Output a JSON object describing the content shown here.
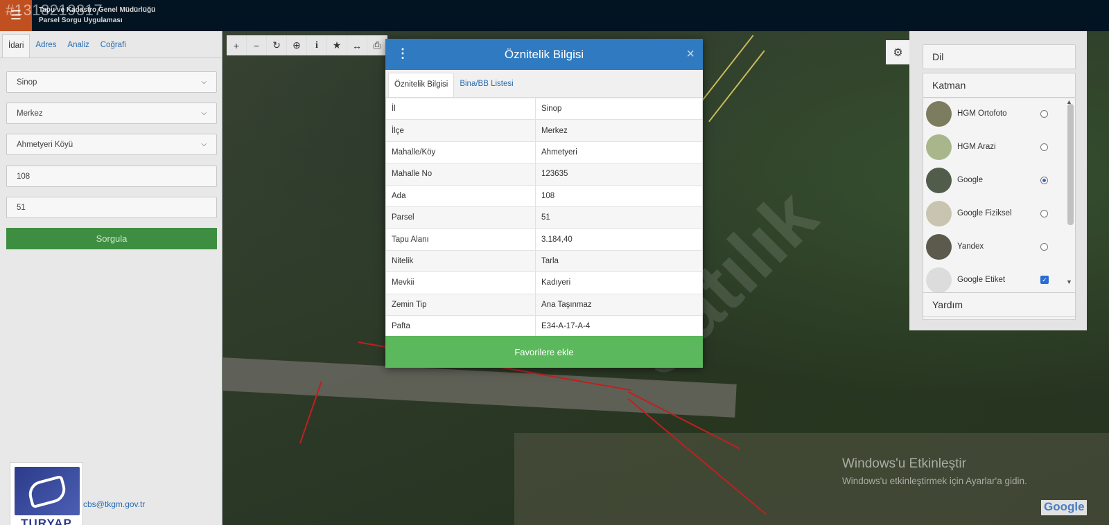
{
  "header": {
    "listing_id": "#1318219317",
    "title_line1": "Tapu ve Kadastro Genel Müdürlüğü",
    "title_line2": "Parsel Sorgu Uygulaması",
    "menu_icon": "hamburger-icon"
  },
  "left_panel": {
    "tabs": [
      {
        "label": "İdari",
        "active": true
      },
      {
        "label": "Adres"
      },
      {
        "label": "Analiz"
      },
      {
        "label": "Coğrafi"
      }
    ],
    "il": "Sinop",
    "ilce": "Merkez",
    "mahalle": "Ahmetyeri Köyü",
    "ada": "108",
    "parsel": "51",
    "submit_label": "Sorgula",
    "contact_email": "cbs@tkgm.gov.tr",
    "logo_text": "TURYAP"
  },
  "map": {
    "toolbar_icons": [
      "zoom-in-icon",
      "zoom-out-icon",
      "refresh-icon",
      "locate-icon",
      "info-icon",
      "star-icon",
      "measure-icon",
      "print-icon"
    ],
    "watermark_text": "Satılık",
    "activation_title": "Windows'u Etkinleştir",
    "activation_subtitle": "Windows'u etkinleştirmek için Ayarlar'a gidin.",
    "google_logo": "Google"
  },
  "layer_panel": {
    "dil_label": "Dil",
    "katman_label": "Katman",
    "yardim_label": "Yardım",
    "layers": [
      {
        "label": "HGM Ortofoto",
        "selected": false,
        "color": "#7c7c5e"
      },
      {
        "label": "HGM Arazi",
        "selected": false,
        "color": "#a9b68c"
      },
      {
        "label": "Google",
        "selected": true,
        "color": "#525c4a"
      },
      {
        "label": "Google Fiziksel",
        "selected": false,
        "color": "#c9c4b0"
      },
      {
        "label": "Yandex",
        "selected": false,
        "color": "#5c5a4c"
      },
      {
        "label": "Google Etiket",
        "checked": true,
        "color": "#dcdcdc"
      }
    ]
  },
  "modal": {
    "title": "Öznitelik Bilgisi",
    "tabs": [
      {
        "label": "Öznitelik Bilgisi",
        "active": true
      },
      {
        "label": "Bina/BB Listesi"
      }
    ],
    "rows": [
      {
        "key": "İl",
        "value": "Sinop"
      },
      {
        "key": "İlçe",
        "value": "Merkez"
      },
      {
        "key": "Mahalle/Köy",
        "value": "Ahmetyeri"
      },
      {
        "key": "Mahalle No",
        "value": "123635"
      },
      {
        "key": "Ada",
        "value": "108"
      },
      {
        "key": "Parsel",
        "value": "51"
      },
      {
        "key": "Tapu Alanı",
        "value": "3.184,40"
      },
      {
        "key": "Nitelik",
        "value": "Tarla"
      },
      {
        "key": "Mevkii",
        "value": "Kadıyeri"
      },
      {
        "key": "Zemin Tip",
        "value": "Ana Taşınmaz"
      },
      {
        "key": "Pafta",
        "value": "E34-A-17-A-4"
      }
    ],
    "favorite_label": "Favorilere ekle"
  }
}
